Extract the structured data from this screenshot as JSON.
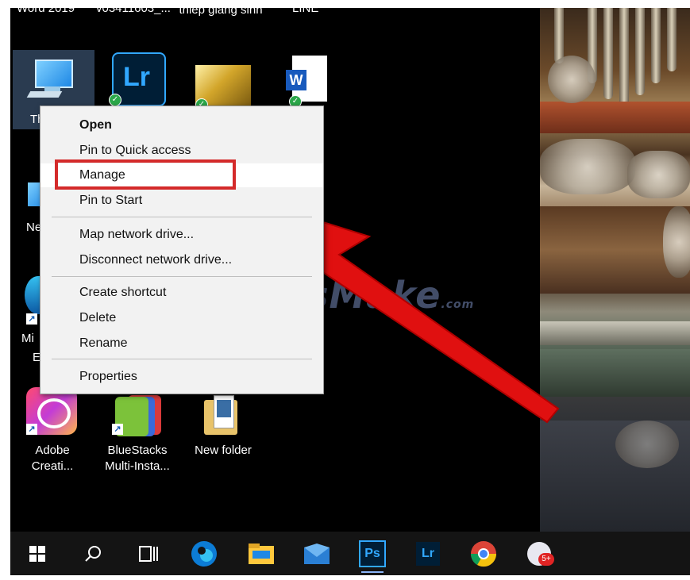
{
  "top_labels": [
    "Word 2019",
    "v03411603_...",
    "thiep giang sinh",
    "LINE"
  ],
  "desktop_icons": {
    "this_pc": "Th",
    "network": "Ne",
    "edge_partial": "Mi",
    "edge_partial2": "E",
    "adobe": [
      "Adobe",
      "Creati..."
    ],
    "bluestacks": [
      "BlueStacks",
      "Multi-Insta..."
    ],
    "new_folder": "New folder"
  },
  "context_menu": {
    "items": [
      {
        "label": "Open",
        "bold": true
      },
      {
        "label": "Pin to Quick access"
      },
      {
        "label": "Manage",
        "highlighted": true
      },
      {
        "label": "Pin to Start"
      },
      {
        "label": "Map network drive..."
      },
      {
        "label": "Disconnect network drive..."
      },
      {
        "label": "Create shortcut"
      },
      {
        "label": "Delete"
      },
      {
        "label": "Rename"
      },
      {
        "label": "Properties"
      }
    ]
  },
  "watermark": {
    "text": "TipsMake",
    "suffix": ".com"
  },
  "taskbar": {
    "items": [
      "windows-start",
      "search",
      "task-view",
      "edge",
      "file-explorer",
      "mail",
      "photoshop",
      "lightroom",
      "chrome",
      "badge-app"
    ],
    "ps_label": "Ps",
    "lr_label": "Lr",
    "lr_tile_label": "Lr",
    "word_tile_label": "W",
    "badge_count": "5+"
  },
  "colors": {
    "highlight_box": "#d42a2a",
    "arrow": "#e01010",
    "menu_bg": "#f2f2f2"
  }
}
